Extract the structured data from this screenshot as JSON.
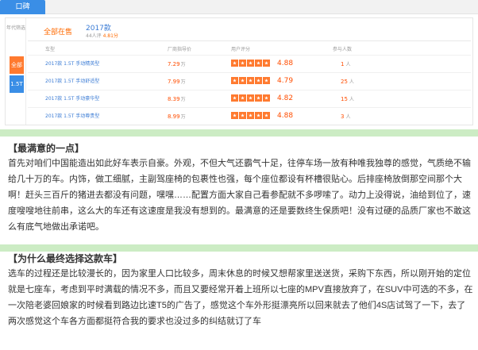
{
  "tab": {
    "label": "口碑"
  },
  "filter": {
    "year_label": "年代筛选",
    "all_label": "全部",
    "engine_label": "1.5T"
  },
  "summary": {
    "status": "全部在售",
    "model_year": "2017款",
    "rating_prefix": "44人评",
    "rating_value": "4.81分"
  },
  "table": {
    "headers": {
      "name": "车型",
      "price": "厂商指导价",
      "rating": "用户评分",
      "users": "参与人数"
    },
    "rows": [
      {
        "name": "2017款 1.5T 手动精英型",
        "price": "7.29",
        "price_unit": "万",
        "score": "4.88",
        "users": "1",
        "users_unit": "人"
      },
      {
        "name": "2017款 1.5T 手动舒适型",
        "price": "7.99",
        "price_unit": "万",
        "score": "4.79",
        "users": "25",
        "users_unit": "人"
      },
      {
        "name": "2017款 1.5T 手动豪华型",
        "price": "8.39",
        "price_unit": "万",
        "score": "4.82",
        "users": "15",
        "users_unit": "人"
      },
      {
        "name": "2017款 1.5T 手动尊贵型",
        "price": "8.99",
        "price_unit": "万",
        "score": "4.88",
        "users": "3",
        "users_unit": "人"
      }
    ]
  },
  "review": {
    "most_satisfied": {
      "title": "【最满意的一点】",
      "body": "首先对咱们中国能造出如此好车表示自豪。外观，不但大气还霸气十足，往停车场一放有种唯我独尊的感觉，气质绝不输给几十万的车。内饰，做工细腻，主副驾座椅的包裹性也强，每个座位都设有杯槽很贴心。后排座椅放倒那空间那个大啊！赶头三百斤的猪进去都没有问题，嘿嘿……配置方面大家自己看参配就不多啰嗦了。动力上没得说，油给到位了，速度嗖嗖地往前串，这么大的车还有这速度是我没有想到的。最满意的还是要数终生保质吧！没有过硬的品质厂家也不敢这么有底气地做出承诺吧。"
    },
    "why_choose": {
      "title": "【为什么最终选择这款车】",
      "body": "选车的过程还是比较漫长的，因为家里人口比较多，周末休息的时候又想帮家里送送货，采购下东西，所以刚开始的定位就是七座车，考虑到平时满载的情况不多，而且又要经常开着上班所以七座的MPV直接放弃了，在SUV中可选的不多，在一次陪老婆回娘家的时候看到路边比速T5的广告了，感觉这个车外形挺漂亮所以回来就去了他们4S店试驾了一下，去了两次感觉这个车各方面都挺符合我的要求也没过多的纠结就订了车"
    }
  },
  "colors": {
    "accent_blue": "#3a8ee6",
    "accent_orange": "#ff7a2f",
    "price_red": "#ff4d00",
    "separator_green": "#ccecc4"
  }
}
